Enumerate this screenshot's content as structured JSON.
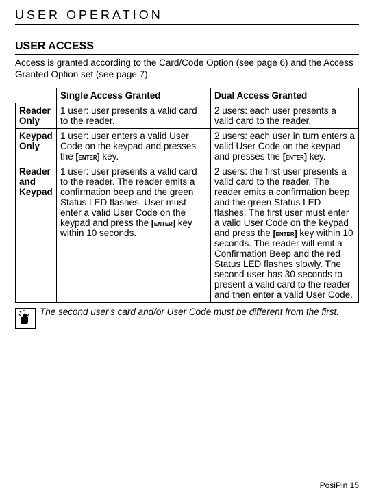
{
  "chapter_title": "USER OPERATION",
  "section_title": "USER ACCESS",
  "intro": "Access is granted according to the Card/Code Option (see page 6) and the Access Granted Option set (see page 7).",
  "table": {
    "head_single": "Single Access Granted",
    "head_dual": "Dual Access Granted",
    "rows": [
      {
        "label_line1": "Reader",
        "label_line2": "Only",
        "single": "1 user: user presents a valid card to the reader.",
        "dual": "2 users: each user presents a valid card to the reader."
      },
      {
        "label_line1": "Keypad",
        "label_line2": "Only",
        "single_pre": "1 user: user enters a valid User Code on the keypad and presses the ",
        "single_key": "[enter]",
        "single_post": " key.",
        "dual_pre": "2 users: each user in turn enters a valid User Code on the keypad and presses the ",
        "dual_key": "[enter]",
        "dual_post": " key."
      },
      {
        "label_line1": "Reader",
        "label_line2": "and",
        "label_line3": "Keypad",
        "single_pre": "1 user: user presents a valid card to the reader. The reader emits a confirmation beep and the green Status LED flashes. User must enter a valid User Code on the keypad and press the ",
        "single_key": "[enter]",
        "single_post": " key within 10 seconds.",
        "dual_pre": "2 users: the first user presents a valid card to the reader. The reader emits a confirmation beep and the green Status LED flashes. The first user must enter a valid User Code on the keypad and press the ",
        "dual_key": "[enter]",
        "dual_post": " key within 10 seconds. The reader will emit a Confirmation Beep and the red Status LED flashes slowly. The second user has 30 seconds to present a valid card to the reader and then enter a valid User Code."
      }
    ]
  },
  "note_text": "The second user's card and/or User Code must be different from the first.",
  "footer": "PosiPin 15"
}
